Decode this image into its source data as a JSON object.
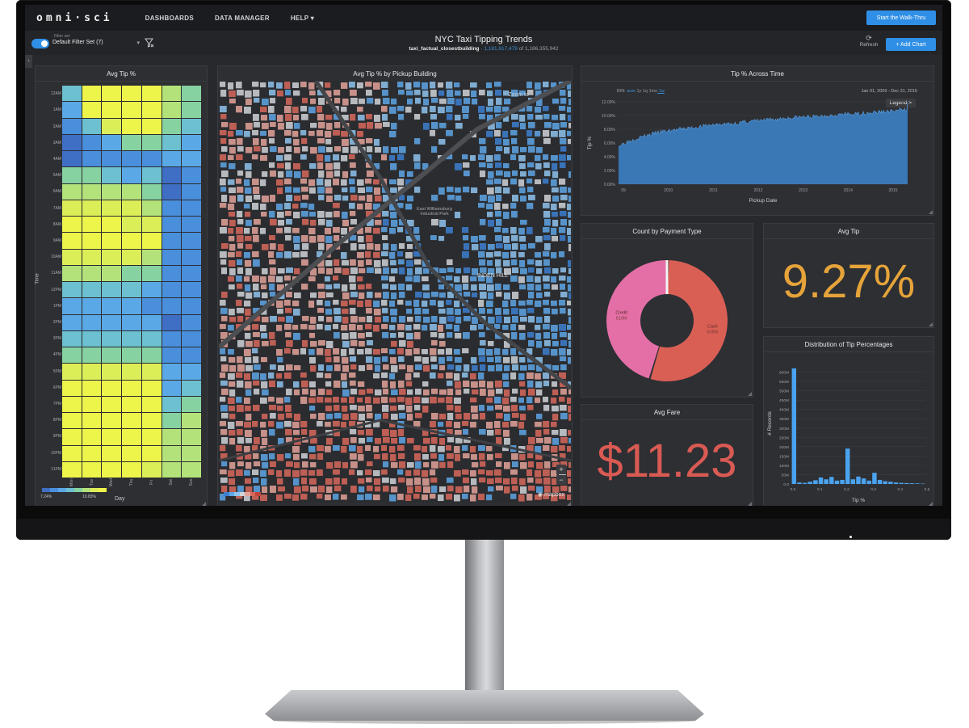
{
  "app": {
    "logo": "omni·sci",
    "nav": [
      "DASHBOARDS",
      "DATA MANAGER",
      "HELP ▾"
    ],
    "walkthru_label": "Start the Walk-Thru"
  },
  "toolbar": {
    "filter_caption": "Filter set",
    "filter_value": "Default Filter Set (7)",
    "dashboard_title": "NYC Taxi Tipping Trends",
    "table_name": "taxi_factual_closestbuilding",
    "separator": "·",
    "filtered_count": "1,181,617,479",
    "of_label": "of",
    "total_count": "1,186,355,942",
    "refresh_label": "Refresh",
    "add_chart_label": "+ Add Chart"
  },
  "heatmap": {
    "title": "Avg Tip %",
    "ylabel": "Time",
    "xlabel": "Day",
    "hours": [
      "12AM",
      "1AM",
      "2AM",
      "3AM",
      "4AM",
      "5AM",
      "6AM",
      "7AM",
      "8AM",
      "9AM",
      "10AM",
      "11AM",
      "12PM",
      "1PM",
      "2PM",
      "3PM",
      "4PM",
      "5PM",
      "6PM",
      "7PM",
      "8PM",
      "9PM",
      "10PM",
      "11PM"
    ],
    "days": [
      "Mon",
      "Tue",
      "Wed",
      "Thu",
      "Fri",
      "Sat",
      "Sun"
    ],
    "legend_min": "7.24%",
    "legend_max": "10.83%",
    "palette": [
      "#3f6fc4",
      "#4a8fdc",
      "#5aa9e6",
      "#6cc0cf",
      "#86d2a0",
      "#b4e27a",
      "#dcee57",
      "#eef54a"
    ],
    "levels": [
      [
        3,
        7,
        7,
        7,
        7,
        5,
        4
      ],
      [
        2,
        7,
        7,
        7,
        7,
        5,
        4
      ],
      [
        1,
        3,
        6,
        7,
        7,
        4,
        3
      ],
      [
        0,
        1,
        2,
        4,
        4,
        3,
        2
      ],
      [
        0,
        1,
        1,
        1,
        1,
        2,
        2
      ],
      [
        4,
        4,
        3,
        2,
        3,
        0,
        1
      ],
      [
        5,
        5,
        5,
        5,
        4,
        0,
        1
      ],
      [
        6,
        6,
        6,
        6,
        5,
        1,
        1
      ],
      [
        7,
        7,
        7,
        6,
        6,
        1,
        1
      ],
      [
        7,
        7,
        7,
        7,
        7,
        1,
        1
      ],
      [
        6,
        6,
        6,
        6,
        5,
        1,
        1
      ],
      [
        5,
        5,
        5,
        4,
        4,
        1,
        1
      ],
      [
        3,
        3,
        3,
        3,
        2,
        1,
        1
      ],
      [
        2,
        2,
        2,
        2,
        1,
        1,
        1
      ],
      [
        2,
        2,
        2,
        2,
        2,
        0,
        1
      ],
      [
        3,
        3,
        3,
        3,
        3,
        1,
        1
      ],
      [
        4,
        4,
        4,
        4,
        4,
        1,
        1
      ],
      [
        6,
        6,
        6,
        6,
        6,
        2,
        2
      ],
      [
        7,
        7,
        7,
        7,
        7,
        2,
        3
      ],
      [
        7,
        7,
        7,
        7,
        7,
        3,
        4
      ],
      [
        7,
        7,
        7,
        7,
        7,
        4,
        5
      ],
      [
        7,
        7,
        7,
        7,
        7,
        5,
        5
      ],
      [
        7,
        7,
        7,
        7,
        7,
        5,
        5
      ],
      [
        7,
        7,
        7,
        7,
        6,
        5,
        5
      ]
    ]
  },
  "map": {
    "title": "Avg Tip % by Pickup Building",
    "zoom_to": "Zoom to",
    "label_park": "East Williamsburg\nIndustrial Park",
    "label_hill": "INDEN HILL",
    "zoom_in": "+",
    "zoom_out": "−",
    "attribution": "mapbox",
    "colors": [
      "#3d7fd0",
      "#5ea6e5",
      "#8ec3ec",
      "#cfd4d8",
      "#e3a39a",
      "#d8685c",
      "#c0443a"
    ]
  },
  "tip_time": {
    "title": "Tip % Across Time",
    "bin_label": "BIN:",
    "bins": [
      "auto",
      "1y",
      "1q",
      "1mo",
      "1w"
    ],
    "active_bin": "1w",
    "date_range": "Jan 01, 2009 - Dec 31, 2015",
    "legend_label": "Legend >",
    "chart_data": {
      "type": "area",
      "xlabel": "Pickup Date",
      "ylabel": "Tip %",
      "x_ticks": [
        "09",
        "2010",
        "2011",
        "2012",
        "2013",
        "2014",
        "2015"
      ],
      "y_ticks": [
        "0.00%",
        "2.00%",
        "4.00%",
        "6.00%",
        "8.00%",
        "10.00%",
        "12.00%"
      ],
      "ylim": [
        0,
        12
      ],
      "x": [
        "2009-01",
        "2009-04",
        "2009-07",
        "2009-10",
        "2010-01",
        "2010-04",
        "2010-07",
        "2010-10",
        "2011-01",
        "2011-04",
        "2011-07",
        "2011-10",
        "2012-01",
        "2012-04",
        "2012-07",
        "2012-10",
        "2013-01",
        "2013-04",
        "2013-07",
        "2013-10",
        "2014-01",
        "2014-04",
        "2014-07",
        "2014-10",
        "2015-01",
        "2015-04",
        "2015-07",
        "2015-10",
        "2015-12"
      ],
      "values": [
        5.6,
        6.3,
        6.8,
        7.2,
        7.6,
        7.8,
        8.0,
        8.2,
        8.4,
        8.6,
        8.7,
        8.8,
        9.0,
        9.2,
        9.3,
        9.4,
        9.6,
        9.7,
        9.8,
        9.8,
        10.0,
        10.1,
        10.2,
        10.2,
        10.4,
        10.5,
        10.6,
        10.7,
        12.0
      ]
    },
    "color": "#3b7bbd"
  },
  "payment": {
    "title": "Count by Payment Type",
    "chart_data": {
      "type": "pie",
      "categories": [
        "Cash",
        "Credit"
      ],
      "labels": [
        "608M",
        "510M"
      ],
      "values": [
        608,
        510
      ],
      "colors": [
        "#d95f55",
        "#e36fa6"
      ]
    }
  },
  "avg_tip": {
    "title": "Avg Tip",
    "value": "9.27%",
    "color": "#e6a33a"
  },
  "avg_fare": {
    "title": "Avg Fare",
    "value": "$11.23",
    "color": "#d95a53"
  },
  "tip_dist": {
    "title": "Distribution of Tip Percentages",
    "color": "#4aa3f0",
    "chart_data": {
      "type": "bar",
      "xlabel": "Tip %",
      "ylabel": "# Records",
      "x_ticks": [
        "0.0",
        "0.1",
        "0.2",
        "0.3",
        "0.4",
        "0.5"
      ],
      "y_ticks": [
        "0.0",
        "50M",
        "100M",
        "150M",
        "200M",
        "250M",
        "300M",
        "350M",
        "400M",
        "450M",
        "500M",
        "550M",
        "600M"
      ],
      "ylim": [
        0,
        650
      ],
      "x": [
        0.0,
        0.02,
        0.04,
        0.06,
        0.08,
        0.1,
        0.12,
        0.14,
        0.16,
        0.18,
        0.2,
        0.22,
        0.24,
        0.26,
        0.28,
        0.3,
        0.32,
        0.34,
        0.36,
        0.38,
        0.4,
        0.42,
        0.44,
        0.46,
        0.48
      ],
      "values": [
        620,
        8,
        6,
        12,
        20,
        35,
        25,
        38,
        18,
        22,
        190,
        25,
        40,
        30,
        18,
        60,
        22,
        15,
        12,
        8,
        6,
        5,
        4,
        3,
        2
      ]
    }
  }
}
